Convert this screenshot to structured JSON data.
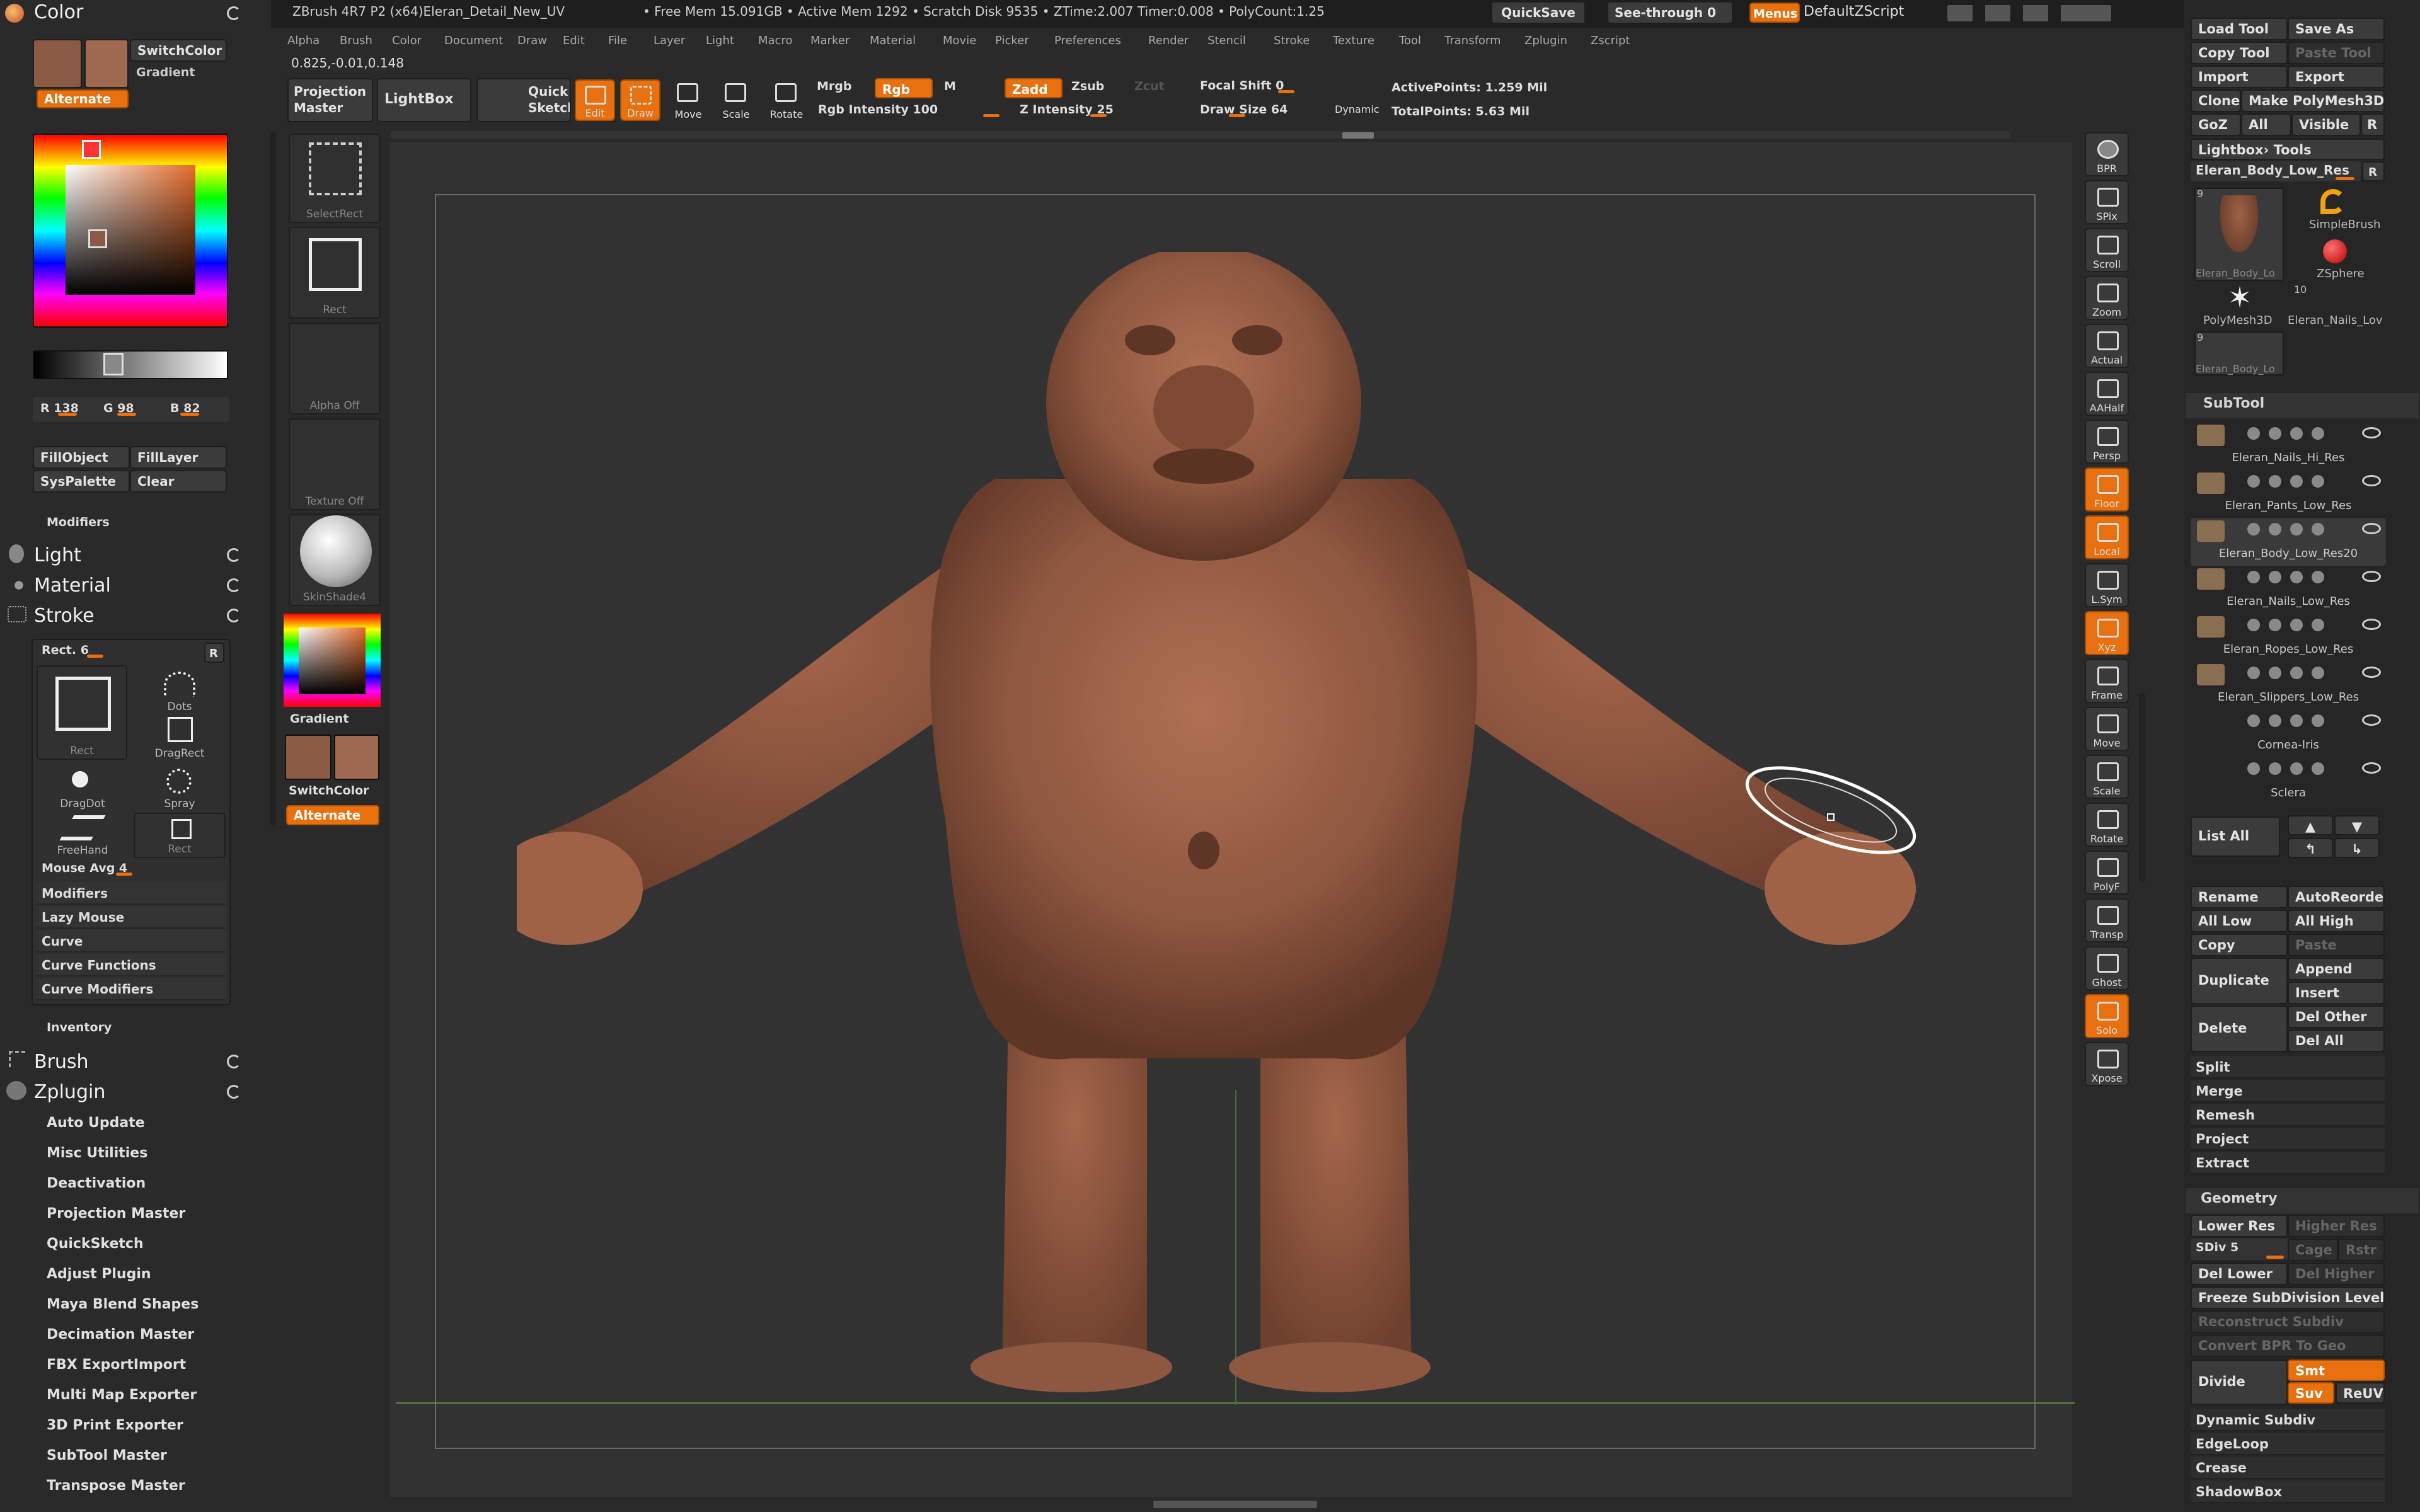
{
  "title_bar": {
    "title": "ZBrush 4R7 P2 (x64)Eleran_Detail_New_UV",
    "stats": "• Free Mem 15.091GB • Active Mem 1292 • Scratch Disk 9535 • ZTime:2.007 Timer:0.008 • PolyCount:1.25",
    "quicksave": "QuickSave",
    "seethrough": "See-through  0",
    "menus": "Menus",
    "script": "DefaultZScript"
  },
  "menu_bar": [
    "Alpha",
    "Brush",
    "Color",
    "Document",
    "Draw",
    "Edit",
    "File",
    "Layer",
    "Light",
    "Macro",
    "Marker",
    "Material",
    "Movie",
    "Picker",
    "Preferences",
    "Render",
    "Stencil",
    "Stroke",
    "Texture",
    "Tool",
    "Transform",
    "Zplugin",
    "Zscript"
  ],
  "coords": "0.825,-0.01,0.148",
  "toolbar": {
    "projection_master": "Projection Master",
    "lightbox": "LightBox",
    "quick_sketch": "Quick Sketch",
    "edit": "Edit",
    "draw": "Draw",
    "move": "Move",
    "scale": "Scale",
    "rotate": "Rotate",
    "mrgb": "Mrgb",
    "rgb": "Rgb",
    "m": "M",
    "rgb_intensity": "Rgb Intensity 100",
    "zadd": "Zadd",
    "zsub": "Zsub",
    "zcut": "Zcut",
    "z_intensity": "Z Intensity 25",
    "focal_shift": "Focal Shift 0",
    "draw_size": "Draw Size 64",
    "dynamic": "Dynamic",
    "active_points": "ActivePoints: 1.259  Mil",
    "total_points": "TotalPoints: 5.63  Mil"
  },
  "left_panel": {
    "color_header": "Color",
    "switchcolor": "SwitchColor",
    "gradient": "Gradient",
    "alternate": "Alternate",
    "r": "R 138",
    "g": "G 98",
    "b": "B 82",
    "fillobject": "FillObject",
    "filllayer": "FillLayer",
    "syspalette": "SysPalette",
    "clear": "Clear",
    "modifiers": "Modifiers",
    "light": "Light",
    "material": "Material",
    "stroke": "Stroke",
    "stroke_panel": {
      "rect": "Rect. 6",
      "r": "R",
      "icons": [
        "Rect",
        "Dots",
        "DragRect",
        "DragDot",
        "Spray",
        "FreeHand",
        "Rect"
      ],
      "mouse_avg": "Mouse Avg 4",
      "items": [
        "Modifiers",
        "Lazy Mouse",
        "Curve",
        "Curve Functions",
        "Curve Modifiers"
      ]
    },
    "inventory": "Inventory",
    "brush": "Brush",
    "zplugin": "Zplugin",
    "zplugin_items": [
      "Auto Update",
      "Misc Utilities",
      "Deactivation",
      "Projection Master",
      "QuickSketch",
      "Adjust Plugin",
      "Maya Blend Shapes",
      "Decimation Master",
      "FBX ExportImport",
      "Multi Map Exporter",
      "3D Print Exporter",
      "SubTool Master",
      "Transpose Master"
    ]
  },
  "tool_strip": {
    "tiles": [
      "SelectRect",
      "Rect",
      "Alpha Off",
      "Texture Off",
      "SkinShade4"
    ],
    "gradient": "Gradient",
    "switchcolor": "SwitchColor",
    "alternate": "Alternate"
  },
  "right_strip": [
    "BPR",
    "SPix",
    "Scroll",
    "Zoom",
    "Actual",
    "AAHalf",
    "Persp",
    "Floor",
    "Local",
    "L.Sym",
    "Xyz",
    "Frame",
    "Move",
    "Scale",
    "Rotate",
    "PolyF",
    "Transp",
    "Ghost",
    "Solo",
    "Xpose"
  ],
  "right_panel": {
    "load_tool": "Load Tool",
    "save_as": "Save As",
    "copy_tool": "Copy Tool",
    "paste_tool": "Paste Tool",
    "import": "Import",
    "export": "Export",
    "clone": "Clone",
    "make_polymesh": "Make PolyMesh3D",
    "goz": "GoZ",
    "all": "All",
    "visible": "Visible",
    "r": "R",
    "lightbox_tools": "Lightbox› Tools",
    "current_tool": "Eleran_Body_Low_Res",
    "r2": "R",
    "tools": [
      {
        "name": "Eleran_Body_Lo",
        "badge": "9"
      },
      {
        "name": "SimpleBrush"
      },
      {
        "name": "ZSphere"
      },
      {
        "name": "PolyMesh3D"
      },
      {
        "name": "Eleran_Nails_Lov",
        "badge": "10"
      },
      {
        "name": "Eleran_Body_Lo",
        "badge": "9"
      }
    ],
    "subtool_header": "SubTool",
    "subtools": [
      "Eleran_Nails_Hi_Res",
      "Eleran_Pants_Low_Res",
      "Eleran_Body_Low_Res20",
      "Eleran_Nails_Low_Res",
      "Eleran_Ropes_Low_Res",
      "Eleran_Slippers_Low_Res",
      "Cornea-Iris",
      "Sclera"
    ],
    "list_all": "List All",
    "rename": "Rename",
    "autoreorder": "AutoReorde",
    "all_low": "All Low",
    "all_high": "All High",
    "copy": "Copy",
    "paste": "Paste",
    "duplicate": "Duplicate",
    "append": "Append",
    "insert": "Insert",
    "delete": "Delete",
    "del_other": "Del Other",
    "del_all": "Del All",
    "actions": [
      "Split",
      "Merge",
      "Remesh",
      "Project",
      "Extract"
    ],
    "geometry_header": "Geometry",
    "lower_res": "Lower Res",
    "higher_res": "Higher Res",
    "sdiv": "SDiv 5",
    "cage": "Cage",
    "rstr": "Rstr",
    "del_lower": "Del Lower",
    "del_higher": "Del Higher",
    "freeze": "Freeze SubDivision Levels",
    "reconstruct": "Reconstruct Subdiv",
    "convert_bpr": "Convert BPR To Geo",
    "divide": "Divide",
    "smt": "Smt",
    "suv": "Suv",
    "reuv": "ReUV",
    "geo_items": [
      "Dynamic Subdiv",
      "EdgeLoop",
      "Crease",
      "ShadowBox"
    ]
  },
  "colors": {
    "accent": "#e8700f",
    "skin": "#8a5a44",
    "bg": "#2a2a2a"
  }
}
